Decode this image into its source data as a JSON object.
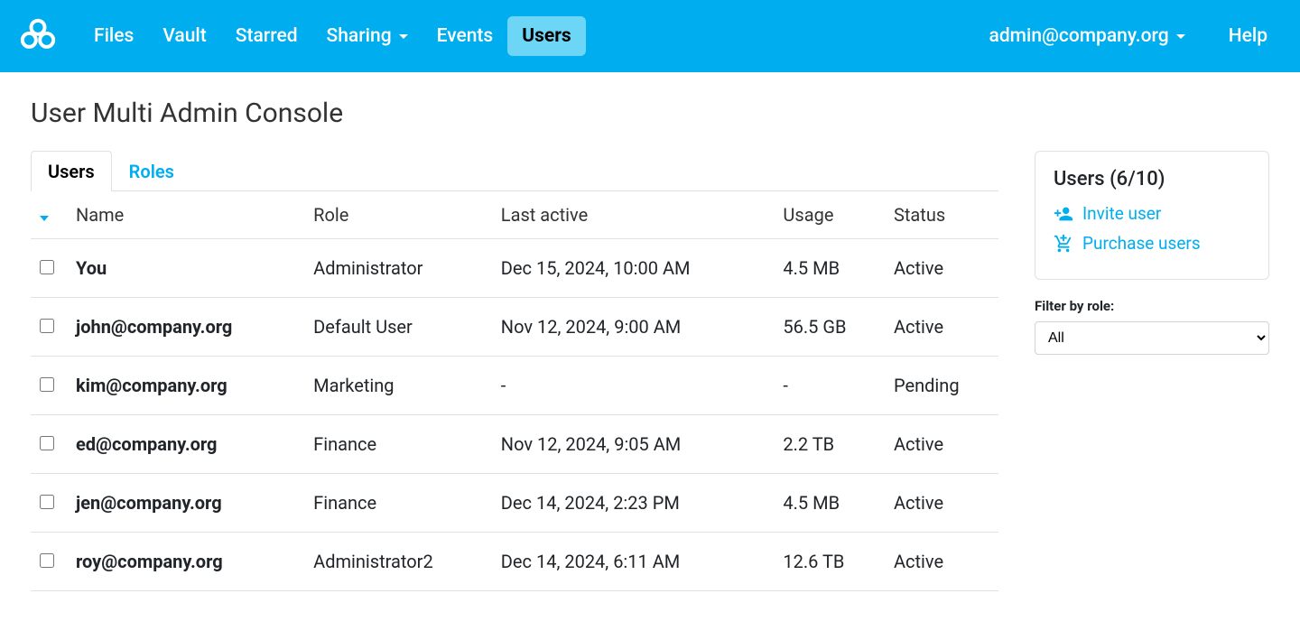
{
  "nav": {
    "items": [
      {
        "label": "Files",
        "active": false,
        "dropdown": false
      },
      {
        "label": "Vault",
        "active": false,
        "dropdown": false
      },
      {
        "label": "Starred",
        "active": false,
        "dropdown": false
      },
      {
        "label": "Sharing",
        "active": false,
        "dropdown": true
      },
      {
        "label": "Events",
        "active": false,
        "dropdown": false
      },
      {
        "label": "Users",
        "active": true,
        "dropdown": false
      }
    ],
    "account": "admin@company.org",
    "help": "Help"
  },
  "page": {
    "title": "User Multi Admin Console"
  },
  "tabs": [
    {
      "label": "Users",
      "active": true
    },
    {
      "label": "Roles",
      "active": false
    }
  ],
  "table": {
    "headers": {
      "name": "Name",
      "role": "Role",
      "last_active": "Last active",
      "usage": "Usage",
      "status": "Status"
    },
    "rows": [
      {
        "name": "You",
        "role": "Administrator",
        "last_active": "Dec 15, 2024, 10:00 AM",
        "usage": "4.5 MB",
        "status": "Active"
      },
      {
        "name": "john@company.org",
        "role": "Default User",
        "last_active": "Nov 12, 2024, 9:00 AM",
        "usage": "56.5 GB",
        "status": "Active"
      },
      {
        "name": "kim@company.org",
        "role": "Marketing",
        "last_active": "-",
        "usage": "-",
        "status": "Pending"
      },
      {
        "name": "ed@company.org",
        "role": "Finance",
        "last_active": "Nov 12, 2024, 9:05 AM",
        "usage": "2.2 TB",
        "status": "Active"
      },
      {
        "name": "jen@company.org",
        "role": "Finance",
        "last_active": "Dec 14, 2024, 2:23 PM",
        "usage": "4.5 MB",
        "status": "Active"
      },
      {
        "name": "roy@company.org",
        "role": "Administrator2",
        "last_active": "Dec 14, 2024, 6:11 AM",
        "usage": "12.6 TB",
        "status": "Active"
      }
    ]
  },
  "sidebar": {
    "users_count_label": "Users (6/10)",
    "invite_label": "Invite user",
    "purchase_label": "Purchase users",
    "filter_label": "Filter by role:",
    "filter_value": "All"
  }
}
